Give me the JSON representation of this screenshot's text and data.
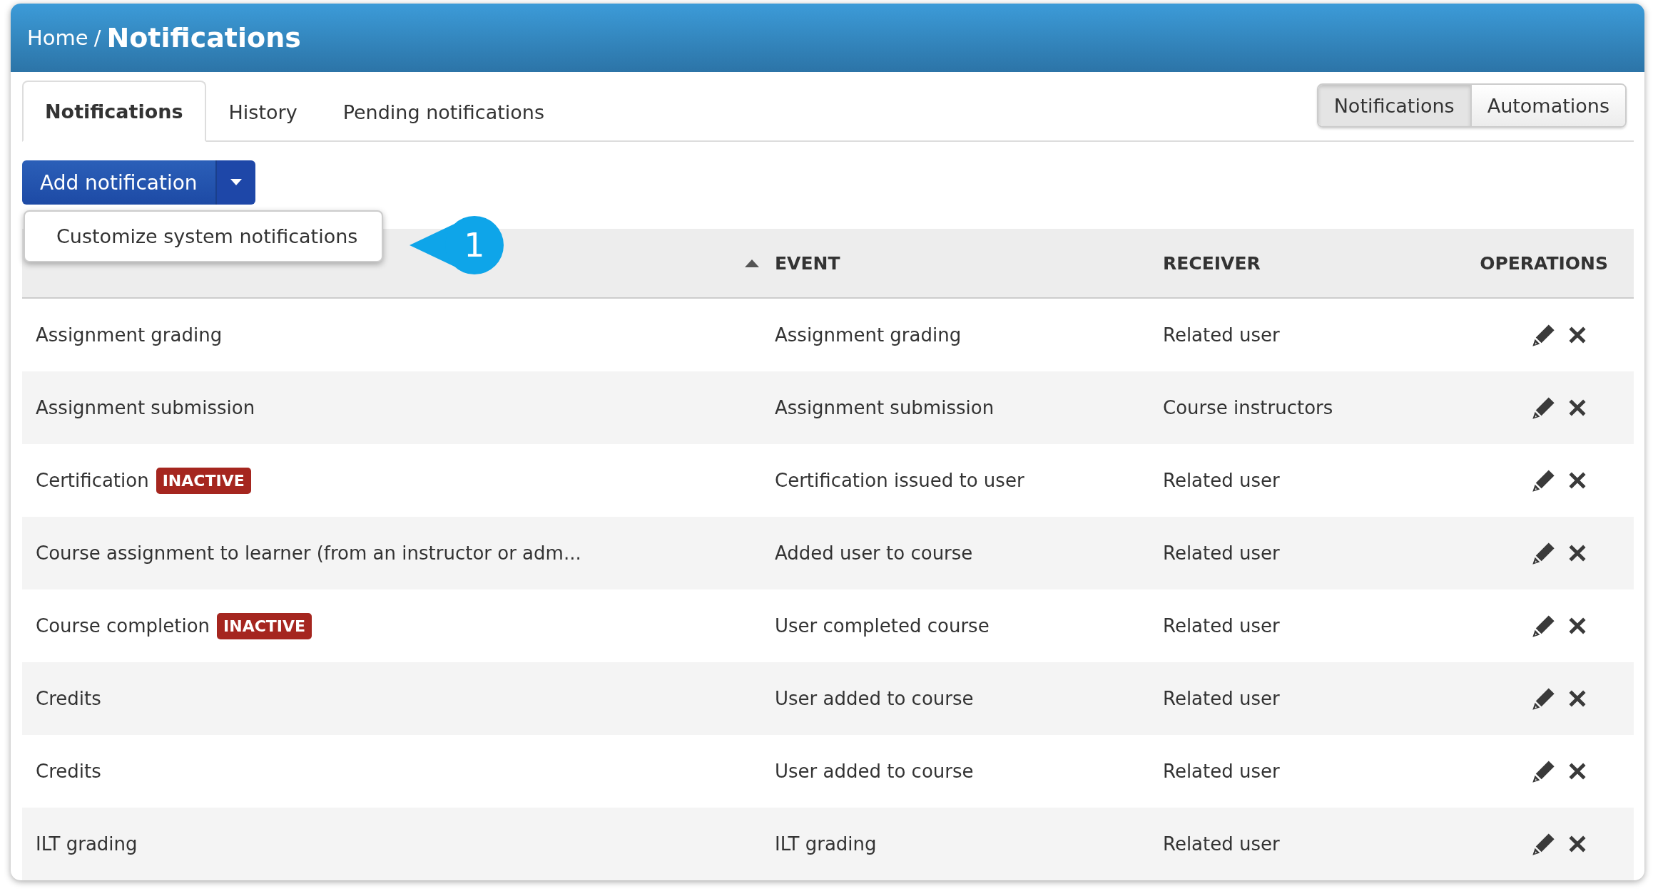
{
  "breadcrumb": {
    "home": "Home",
    "separator": "/",
    "current": "Notifications"
  },
  "tabs": [
    {
      "label": "Notifications",
      "selected": true
    },
    {
      "label": "History",
      "selected": false
    },
    {
      "label": "Pending notifications",
      "selected": false
    }
  ],
  "view_switch": [
    {
      "label": "Notifications",
      "selected": true
    },
    {
      "label": "Automations",
      "selected": false
    }
  ],
  "add_button": {
    "label": "Add notification"
  },
  "dropdown": {
    "items": [
      "Customize system notifications"
    ]
  },
  "callout": {
    "number": "1"
  },
  "table": {
    "columns": [
      {
        "label": "EVENT",
        "sorted": true
      },
      {
        "label": "RECEIVER"
      },
      {
        "label": "OPERATIONS"
      }
    ],
    "rows": [
      {
        "name": "Assignment grading",
        "event": "Assignment grading",
        "receiver": "Related user"
      },
      {
        "name": "Assignment submission",
        "event": "Assignment submission",
        "receiver": "Course instructors"
      },
      {
        "name": "Certification",
        "badge": "INACTIVE",
        "event": "Certification issued to user",
        "receiver": "Related user"
      },
      {
        "name": "Course assignment to learner (from an instructor or adm...",
        "event": "Added user to course",
        "receiver": "Related user"
      },
      {
        "name": "Course completion",
        "badge": "INACTIVE",
        "event": "User completed course",
        "receiver": "Related user"
      },
      {
        "name": "Credits",
        "event": "User added to course",
        "receiver": "Related user"
      },
      {
        "name": "Credits",
        "event": "User added to course",
        "receiver": "Related user"
      },
      {
        "name": "ILT grading",
        "event": "ILT grading",
        "receiver": "Related user"
      }
    ]
  }
}
